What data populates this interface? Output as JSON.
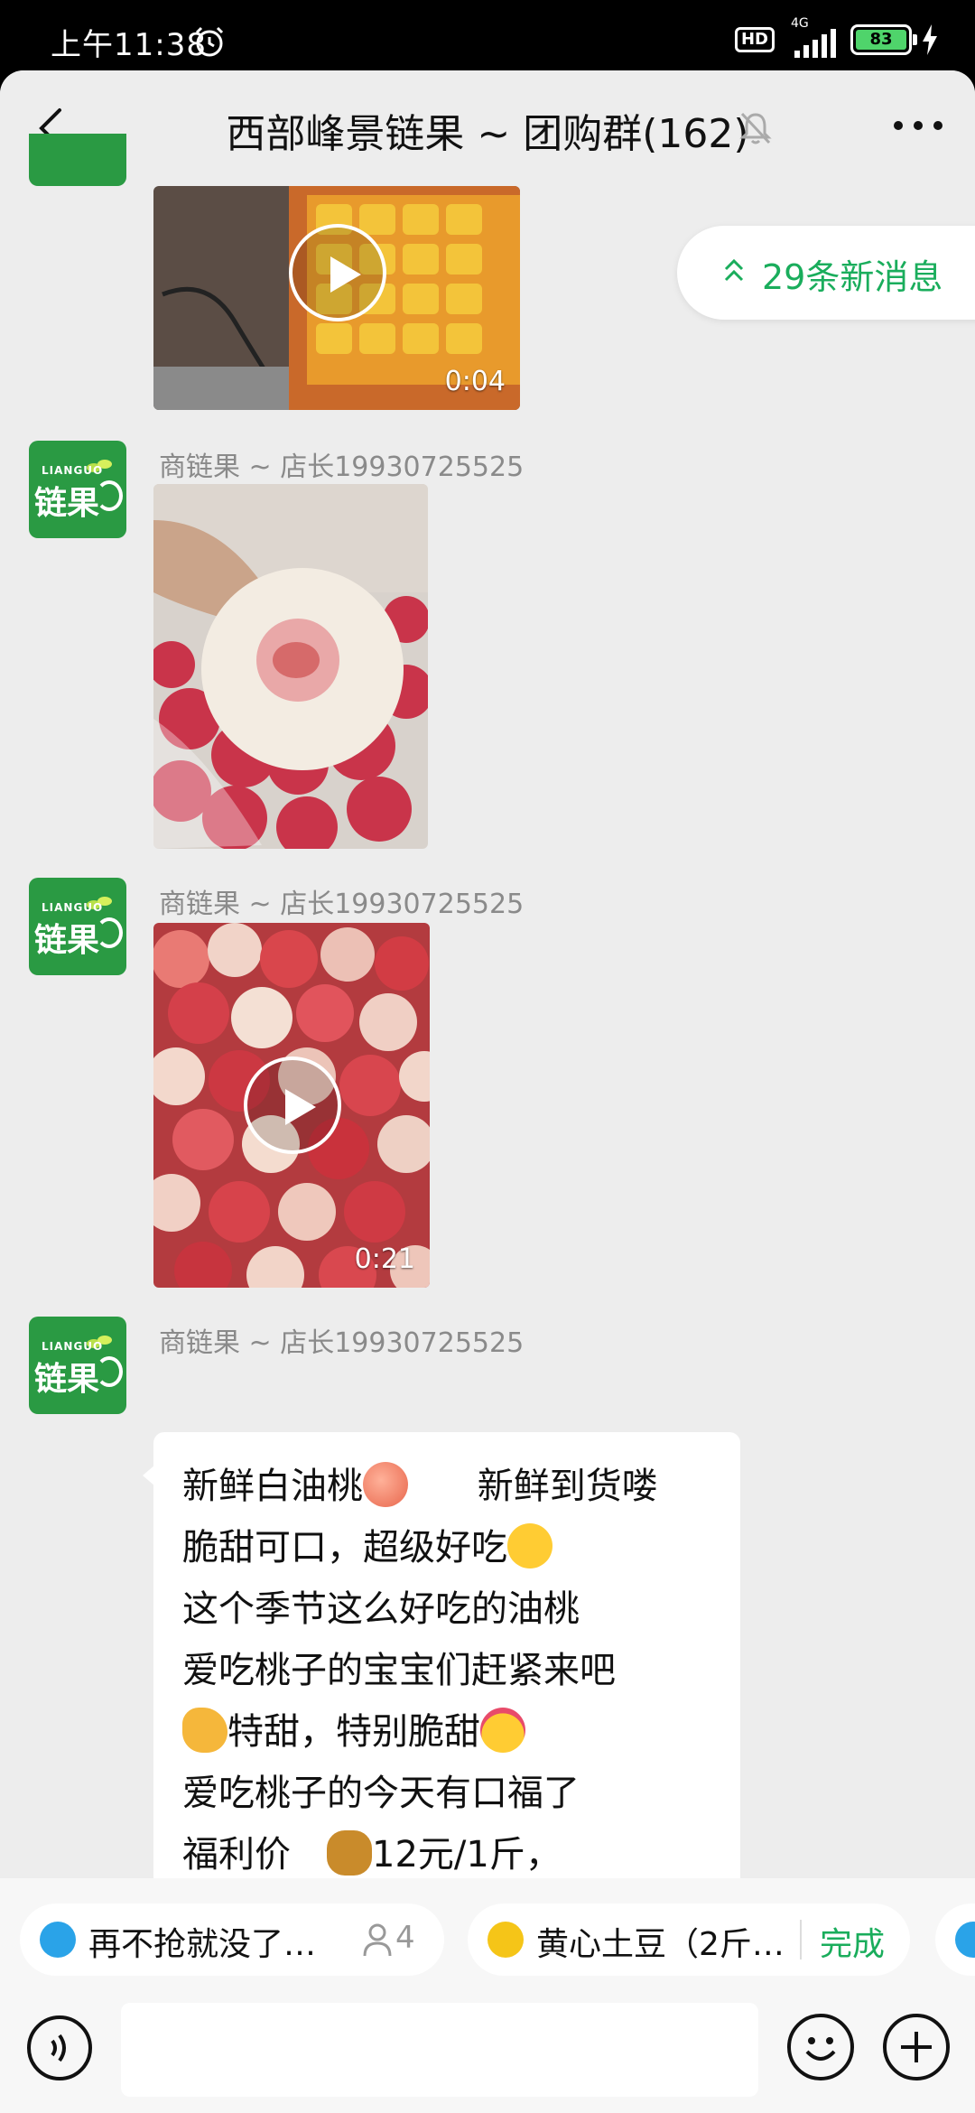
{
  "status_bar": {
    "time": "上午11:38",
    "hd_label": "HD",
    "network_label": "4G",
    "battery": "83"
  },
  "header": {
    "title": "西部峰景链果 ~ 团购群(162)"
  },
  "new_messages": {
    "label": "29条新消息"
  },
  "messages": [
    {
      "type": "video",
      "duration": "0:04"
    },
    {
      "type": "image",
      "sender": "商链果 ~ 店长19930725525",
      "avatar_small": "LIANGUO",
      "avatar_big": "链果"
    },
    {
      "type": "video",
      "sender": "商链果 ~ 店长19930725525",
      "avatar_small": "LIANGUO",
      "avatar_big": "链果",
      "duration": "0:21"
    },
    {
      "type": "text",
      "sender": "商链果 ~ 店长19930725525",
      "avatar_small": "LIANGUO",
      "avatar_big": "链果",
      "lines": [
        "新鲜白油桃",
        "新鲜到货喽",
        "脆甜可口，超级好吃",
        "这个季节这么好吃的油桃",
        "爱吃桃子的宝宝们赶紧来吧",
        "特甜，特别脆甜",
        "爱吃桃子的今天有口福了",
        "福利价",
        "12元/1斤，"
      ]
    }
  ],
  "group_buy_chips": [
    {
      "label": "再不抢就没了…",
      "count": "4"
    },
    {
      "label": "黄心土豆（2斤…",
      "action": "完成"
    }
  ],
  "colors": {
    "accent_green": "#1aad5c",
    "avatar_green": "#2a9a43",
    "background": "#ededed"
  }
}
